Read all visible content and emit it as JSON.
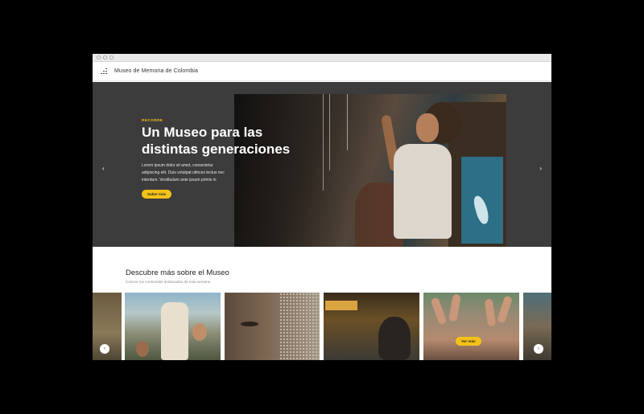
{
  "header": {
    "site_title": "Museo de Memoria de Colombia"
  },
  "hero": {
    "eyebrow": "RECORRE",
    "title": "Un Museo para las distintas generaciones",
    "body": "Lorem ipsum dolor sit amet, consectetur adipiscing elit. Duis volutpat ultrices lectus nec interdum. Vestibulum ante ipsum primis in",
    "button_label": "Saber más",
    "prev_icon": "‹",
    "next_icon": "›"
  },
  "discover": {
    "title": "Descubre más sobre el Museo",
    "subtitle": "Conoce los contenidos destacados de esta semana",
    "tile_button_label": "Ver más",
    "prev_icon": "‹",
    "next_icon": "›"
  },
  "colors": {
    "accent": "#f4c21a",
    "hero_bg": "#3c3c3c"
  }
}
